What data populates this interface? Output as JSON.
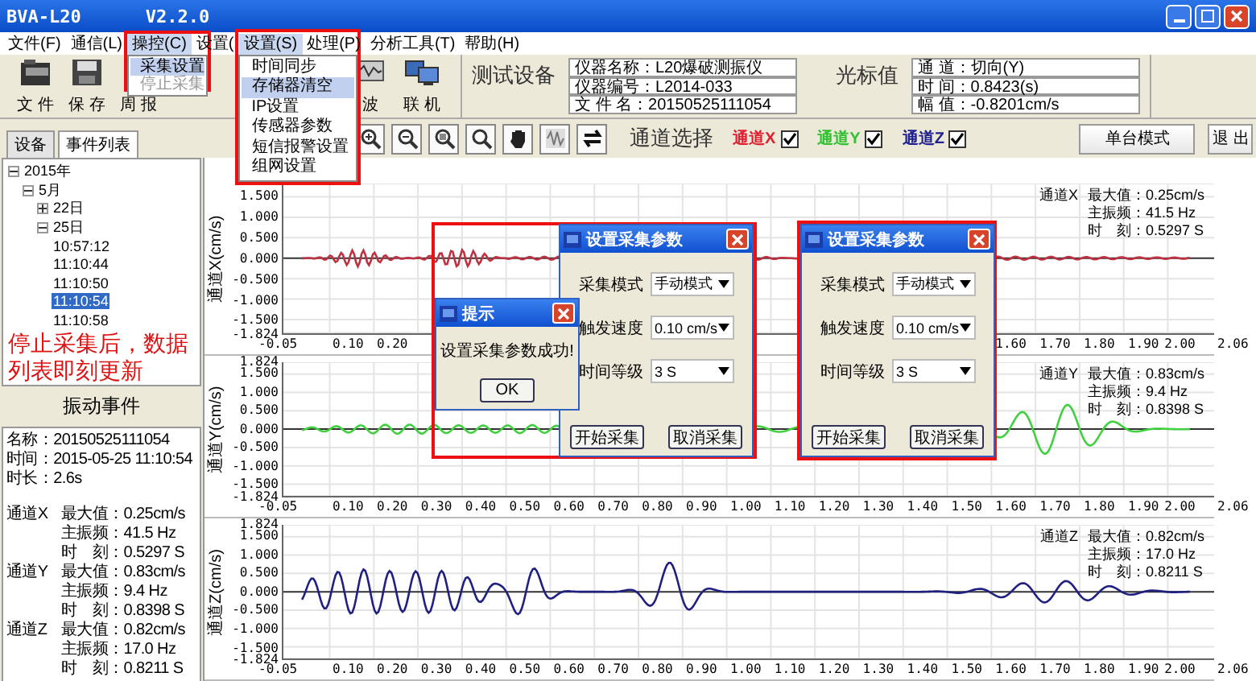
{
  "window": {
    "title": "BVA-L20",
    "version": "V2.2.0"
  },
  "menu": [
    {
      "label": "文件(F)",
      "selected": false
    },
    {
      "label": "通信(L)",
      "selected": false
    },
    {
      "label": "操控(C)",
      "selected": true
    },
    {
      "label": "设置(",
      "selected": false
    },
    {
      "label": "设置(S)",
      "selected": true
    },
    {
      "label": "处理(P)",
      "selected": false
    },
    {
      "label": "分析工具(T)",
      "selected": false
    },
    {
      "label": "帮助(H)",
      "selected": false
    }
  ],
  "control_menu": [
    {
      "label": "采集设置",
      "selected": true,
      "disabled": false
    },
    {
      "label": "停止采集",
      "selected": false,
      "disabled": true
    }
  ],
  "settings_menu": [
    {
      "label": "时间同步",
      "selected": false
    },
    {
      "label": "存储器清空",
      "selected": true
    },
    {
      "label": "IP设置",
      "selected": false
    },
    {
      "label": "传感器参数",
      "selected": false
    },
    {
      "label": "短信报警设置",
      "selected": false
    },
    {
      "label": "组网设置",
      "selected": false
    }
  ],
  "toolbar": [
    {
      "label": "文 件",
      "kind": "folder"
    },
    {
      "label": "保 存",
      "kind": "disk"
    },
    {
      "label": "周 报"
    },
    {
      "label": "波",
      "kind": "wave"
    },
    {
      "label": "联 机",
      "kind": "network"
    }
  ],
  "device": {
    "title": "测试设备",
    "fields": [
      "仪器名称：L20爆破测振仪",
      "仪器编号：L2014-033",
      "文 件 名：20150525111054"
    ]
  },
  "cursor": {
    "title": "光标值",
    "fields": [
      "通 道：切向(Y)",
      "时 间：0.8423(s)",
      "幅 值：-0.8201cm/s"
    ]
  },
  "tabs": [
    {
      "label": "设备",
      "selected": false
    },
    {
      "label": "事件列表",
      "selected": true
    }
  ],
  "channel_select": {
    "label": "通道选择",
    "channels": [
      {
        "label": "通道X",
        "color": "#e02030",
        "checked": true
      },
      {
        "label": "通道Y",
        "color": "#30c030",
        "checked": true
      },
      {
        "label": "通道Z",
        "color": "#202090",
        "checked": true
      }
    ]
  },
  "buttons": [
    "单台模式",
    "退 出"
  ],
  "tree": [
    {
      "label": "2015年",
      "expanded": true,
      "selected": false,
      "children": [
        {
          "label": "5月",
          "expanded": true,
          "selected": false,
          "children": [
            {
              "label": "22日",
              "expanded": false,
              "selected": false
            },
            {
              "label": "25日",
              "expanded": true,
              "selected": false,
              "children": [
                {
                  "label": "10:57:12",
                  "selected": false
                },
                {
                  "label": "11:10:44",
                  "selected": false
                },
                {
                  "label": "11:10:50",
                  "selected": false
                },
                {
                  "label": "11:10:54",
                  "selected": true
                },
                {
                  "label": "11:10:58",
                  "selected": false
                }
              ]
            }
          ]
        }
      ]
    }
  ],
  "note": "停止采集后，数据列表即刻更新",
  "event": {
    "title": "振动事件",
    "lines": [
      "名称：20150525111054",
      "时间：2015-05-25 11:10:54",
      "时长：2.6s"
    ],
    "channels": [
      {
        "name": "通道X",
        "rows": [
          "最大值：0.25cm/s",
          "主振频：41.5 Hz",
          "时　刻：0.5297 S"
        ]
      },
      {
        "name": "通道Y",
        "rows": [
          "最大值：0.83cm/s",
          "主振频：9.4 Hz",
          "时　刻：0.8398 S"
        ]
      },
      {
        "name": "通道Z",
        "rows": [
          "最大值：0.82cm/s",
          "主振频：17.0 Hz",
          "时　刻：0.8211 S"
        ]
      }
    ]
  },
  "charts": [
    {
      "ylabel": "通道X(cm/s)",
      "color": "#c03040",
      "yticks": [
        "1.500",
        "1.000",
        "0.500",
        "0.000",
        "-0.500",
        "-1.000",
        "-1.500",
        "-1.824"
      ],
      "xticks": [
        "-0.05",
        "0.10",
        "0.20"
      ],
      "xticks_end": [
        "1.60",
        "1.70",
        "1.80",
        "1.90",
        "2.00",
        "2.06"
      ],
      "stats": {
        "name": "通道X",
        "rows": [
          "最大值：0.25cm/s",
          "主振频：41.5 Hz",
          "时　刻：0.5297 S"
        ]
      }
    },
    {
      "ylabel": "通道Y(cm/s)",
      "color": "#40d040",
      "yticks": [
        "1.824",
        "1.500",
        "1.000",
        "0.500",
        "0.000",
        "-0.500",
        "-1.000",
        "-1.500",
        "-1.824"
      ],
      "xticks": [
        "-0.05",
        "0.10",
        "0.20",
        "0.30",
        "0.40",
        "0.50",
        "0.60",
        "0.70",
        "0.80",
        "0.90",
        "1.00",
        "1.10",
        "1.20",
        "1.30",
        "1.40",
        "1.50",
        "1.60",
        "1.70",
        "1.80",
        "1.90",
        "2.00",
        "2.06"
      ],
      "stats": {
        "name": "通道Y",
        "rows": [
          "最大值：0.83cm/s",
          "主振频：9.4 Hz",
          "时　刻：0.8398 S"
        ]
      }
    },
    {
      "ylabel": "通道Z(cm/s)",
      "color": "#202080",
      "yticks": [
        "1.824",
        "1.500",
        "1.000",
        "0.500",
        "0.000",
        "-0.500",
        "-1.000",
        "-1.500",
        "-1.824"
      ],
      "xticks": [
        "-0.05",
        "0.10",
        "0.20",
        "0.30",
        "0.40",
        "0.50",
        "0.60",
        "0.70",
        "0.80",
        "0.90",
        "1.00",
        "1.10",
        "1.20",
        "1.30",
        "1.40",
        "1.50",
        "1.60",
        "1.70",
        "1.80",
        "1.90",
        "2.00",
        "2.06"
      ],
      "stats": {
        "name": "通道Z",
        "rows": [
          "最大值：0.82cm/s",
          "主振频：17.0 Hz",
          "时　刻：0.8211 S"
        ]
      }
    }
  ],
  "tip_dialog": {
    "title": "提示",
    "message": "设置采集参数成功!",
    "button": "OK"
  },
  "settings_dialogs": [
    {
      "title": "设置采集参数",
      "fields": [
        {
          "label": "采集模式",
          "value": "手动模式"
        },
        {
          "label": "触发速度",
          "value": "0.10 cm/s"
        },
        {
          "label": "时间等级",
          "value": "3 S"
        }
      ],
      "buttons": [
        "开始采集",
        "取消采集"
      ]
    },
    {
      "title": "设置采集参数",
      "fields": [
        {
          "label": "采集模式",
          "value": "手动模式"
        },
        {
          "label": "触发速度",
          "value": "0.10 cm/s"
        },
        {
          "label": "时间等级",
          "value": "3 S"
        }
      ],
      "buttons": [
        "开始采集",
        "取消采集"
      ]
    }
  ]
}
